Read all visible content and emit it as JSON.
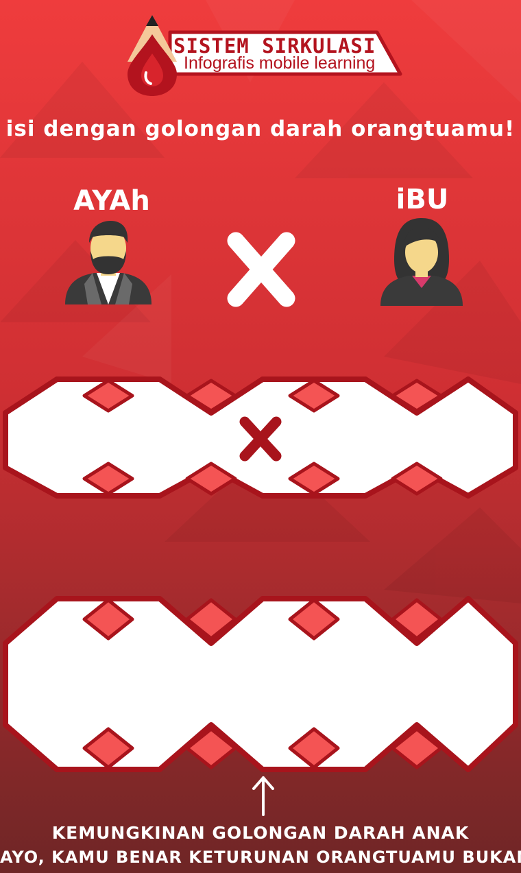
{
  "header": {
    "title": "SISTEM SIRKULASI",
    "subtitle": "Infografis mobile learning"
  },
  "headline": "isi dengan golongan darah orangtuamu!",
  "parents": {
    "father_label": "AYAh",
    "mother_label": "iBU",
    "cross_symbol": "X"
  },
  "parent_blood_input": {
    "cross_symbol": "X",
    "father_value": "",
    "mother_value": ""
  },
  "child_result": {
    "value": ""
  },
  "footer": {
    "line1": "KEMUNGKINAN GOLONGAN DARAH ANAK",
    "line2": "AYO, KAMU BENAR KETURUNAN ORANGTUAMU BUKAN?"
  },
  "colors": {
    "accent_dark": "#a8141c",
    "accent": "#ef3e3f",
    "diamond": "#f45454",
    "panel": "#ffffff"
  },
  "icons": {
    "logo": "blood-drop-pencil-icon",
    "father": "father-avatar-icon",
    "mother": "mother-avatar-icon",
    "arrow": "arrow-up-icon"
  }
}
